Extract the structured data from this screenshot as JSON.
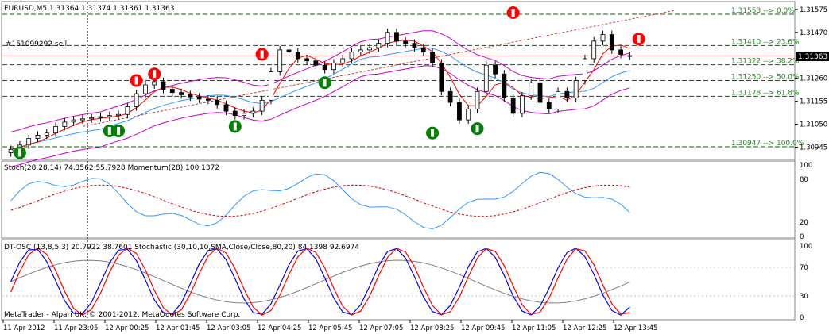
{
  "colors": {
    "background": "#ffffff",
    "frame": "#808080",
    "candle": "#000000",
    "bollinger": "#cc00cc",
    "ma_blue": "#3399ff",
    "ma_red": "#ff0000",
    "fibo": "#006400",
    "fibo_text": "#228b22",
    "trend_dotted": "#c04040",
    "stoch_main": "#3399ff",
    "stoch_signal": "#cc0000",
    "dt_blue": "#0000ff",
    "dt_red": "#ff0000",
    "dt_gray": "#808080",
    "dt_green": "#00cc00",
    "current_price_bg": "#000000",
    "current_price_band": "#ffaaaa",
    "arrow_sell": "#ff0000",
    "arrow_buy": "#008000"
  },
  "main_panel": {
    "title": "EURUSD,M5  1.31364 1.31374 1.31361 1.31363",
    "order_label": "#151099292 sell",
    "current_price": "1.31363",
    "price_range": [
      1.309,
      1.316
    ],
    "price_ticks": [
      "1.31575",
      "1.31470",
      "1.31363",
      "1.31260",
      "1.31155",
      "1.31050",
      "1.30945"
    ],
    "fibo_levels": [
      {
        "price": 1.31553,
        "label": "1.31553 --> 0.0%"
      },
      {
        "price": 1.3141,
        "label": "1.31410 --> 23.6%"
      },
      {
        "price": 1.31322,
        "label": "1.31322 --> 38.2%"
      },
      {
        "price": 1.3125,
        "label": "1.31250 --> 50.0%"
      },
      {
        "price": 1.31178,
        "label": "1.31178 --> 61.8%"
      },
      {
        "price": 1.30947,
        "label": "1.30947 --> 100.0%"
      }
    ],
    "sell_arrows": [
      [
        14,
        1.3125
      ],
      [
        16,
        1.3128
      ],
      [
        28,
        1.3137
      ],
      [
        56,
        1.3156
      ],
      [
        70,
        1.3144
      ]
    ],
    "buy_arrows": [
      [
        1,
        1.3092
      ],
      [
        11,
        1.3102
      ],
      [
        12,
        1.3102
      ],
      [
        25,
        1.3104
      ],
      [
        35,
        1.3124
      ],
      [
        47,
        1.3101
      ],
      [
        52,
        1.3103
      ]
    ]
  },
  "stoch_panel": {
    "title": "Stoch(28,28,14) 74.3562 55.7928  Momentum(28) 100.1372",
    "range": [
      0,
      100
    ],
    "ticks": [
      "100",
      "80",
      "20",
      "0"
    ]
  },
  "dt_panel": {
    "title": "DT-OSC (13,8,5,3) 20.7922 38.7601  Stochastic (30,10,10,SMA,Close/Close,80,20) 84.1398 92.6974",
    "range": [
      0,
      100
    ],
    "ticks": [
      "100",
      "70",
      "30",
      "0"
    ],
    "copyright": "MetaTrader - Alpari UK, © 2001-2012, MetaQuotes Software Corp."
  },
  "time_axis": {
    "labels": [
      "11 Apr 2012",
      "11 Apr 23:05",
      "12 Apr 00:25",
      "12 Apr 01:45",
      "12 Apr 03:05",
      "12 Apr 04:25",
      "12 Apr 05:45",
      "12 Apr 07:05",
      "12 Apr 08:25",
      "12 Apr 09:45",
      "12 Apr 11:05",
      "12 Apr 12:25",
      "12 Apr 13:45"
    ]
  },
  "chart_data": {
    "type": "candlestick",
    "symbol": "EURUSD",
    "timeframe": "M5",
    "ylim": [
      1.309,
      1.316
    ],
    "bar_count": 78,
    "close": [
      1.30935,
      1.30955,
      1.30985,
      1.31,
      1.3101,
      1.3104,
      1.3106,
      1.3107,
      1.31075,
      1.3108,
      1.31085,
      1.3109,
      1.31095,
      1.3113,
      1.3119,
      1.3123,
      1.31245,
      1.3121,
      1.31195,
      1.31185,
      1.31175,
      1.31165,
      1.3116,
      1.3114,
      1.3111,
      1.3109,
      1.311,
      1.3111,
      1.3116,
      1.3129,
      1.3139,
      1.3138,
      1.3135,
      1.3134,
      1.3132,
      1.313,
      1.3133,
      1.3135,
      1.3138,
      1.3139,
      1.314,
      1.3142,
      1.3147,
      1.3143,
      1.3142,
      1.314,
      1.3138,
      1.3133,
      1.312,
      1.3115,
      1.3107,
      1.3112,
      1.312,
      1.3132,
      1.3128,
      1.3117,
      1.311,
      1.3118,
      1.3124,
      1.3115,
      1.3112,
      1.312,
      1.3117,
      1.3125,
      1.3135,
      1.3143,
      1.3146,
      1.3139,
      1.3137,
      1.31363
    ],
    "open": [
      1.3092,
      1.30935,
      1.30955,
      1.30985,
      1.31,
      1.3101,
      1.3104,
      1.3106,
      1.3107,
      1.31075,
      1.3108,
      1.31085,
      1.3109,
      1.31095,
      1.3113,
      1.3119,
      1.3123,
      1.31245,
      1.3121,
      1.31195,
      1.31185,
      1.31175,
      1.31165,
      1.3116,
      1.3114,
      1.3111,
      1.3109,
      1.311,
      1.3111,
      1.3116,
      1.3129,
      1.3139,
      1.3138,
      1.3135,
      1.3134,
      1.3132,
      1.313,
      1.3133,
      1.3135,
      1.3138,
      1.3139,
      1.314,
      1.3142,
      1.3147,
      1.3143,
      1.3142,
      1.314,
      1.3138,
      1.3133,
      1.312,
      1.3115,
      1.3107,
      1.3112,
      1.312,
      1.3132,
      1.3128,
      1.3117,
      1.311,
      1.3118,
      1.3124,
      1.3115,
      1.3112,
      1.312,
      1.3117,
      1.3125,
      1.3135,
      1.3143,
      1.3146,
      1.3139,
      1.31364
    ]
  }
}
